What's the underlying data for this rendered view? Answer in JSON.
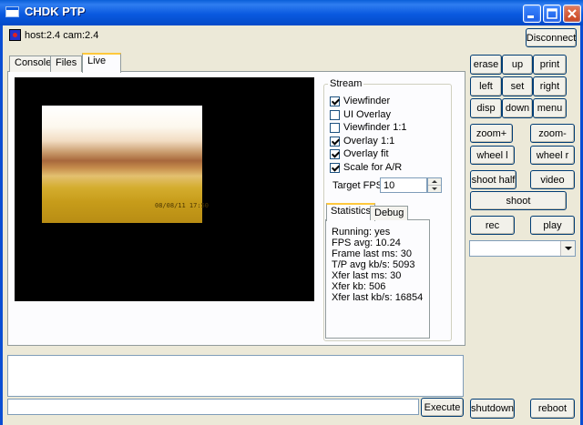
{
  "window": {
    "title": "CHDK PTP"
  },
  "connection": {
    "label": "host:2.4 cam:2.4",
    "disconnect_label": "Disconnect"
  },
  "tabs": [
    {
      "label": "Console",
      "active": false
    },
    {
      "label": "Files",
      "active": false
    },
    {
      "label": "Live",
      "active": true
    }
  ],
  "stream": {
    "legend": "Stream",
    "options": [
      {
        "label": "Viewfinder",
        "checked": true
      },
      {
        "label": "UI Overlay",
        "checked": false
      },
      {
        "label": "Viewfinder 1:1",
        "checked": false
      },
      {
        "label": "Overlay 1:1",
        "checked": true
      },
      {
        "label": "Overlay fit",
        "checked": true
      },
      {
        "label": "Scale for A/R",
        "checked": true
      }
    ],
    "fps_label": "Target FPS",
    "fps_value": "10"
  },
  "stats_tabs": [
    {
      "label": "Statistics",
      "active": true
    },
    {
      "label": "Debug",
      "active": false
    }
  ],
  "statistics": [
    "Running: yes",
    "FPS avg: 10.24",
    "Frame last ms: 30",
    "T/P avg kb/s: 5093",
    "Xfer last ms: 30",
    "Xfer kb: 506",
    "Xfer last kb/s: 16854"
  ],
  "live_image": {
    "date_stamp": "08/08/11  17:50"
  },
  "controls": {
    "erase": "erase",
    "up": "up",
    "print": "print",
    "left": "left",
    "set": "set",
    "right": "right",
    "disp": "disp",
    "down": "down",
    "menu": "menu",
    "zoom_in": "zoom+",
    "zoom_out": "zoom-",
    "wheel_l": "wheel l",
    "wheel_r": "wheel r",
    "shoot_half": "shoot half",
    "video": "video",
    "shoot": "shoot",
    "rec": "rec",
    "play": "play",
    "select_value": ""
  },
  "bottom": {
    "execute_label": "Execute",
    "command_value": "",
    "shutdown_label": "shutdown",
    "reboot_label": "reboot"
  },
  "colors": {
    "titlebar": "#0a5ae0",
    "face": "#ece9d8",
    "tab_highlight": "#ffc83c"
  }
}
